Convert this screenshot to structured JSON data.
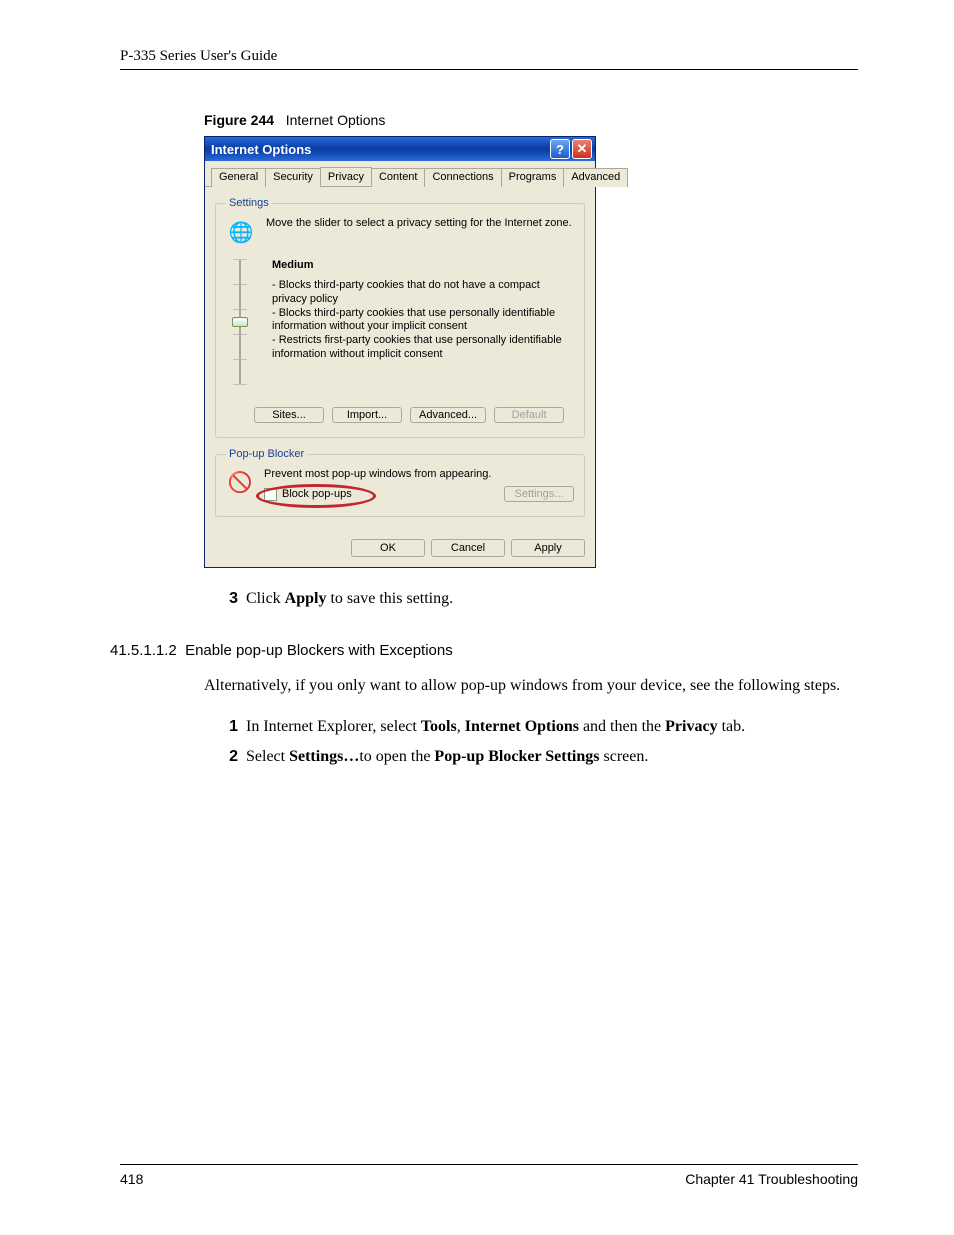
{
  "header": {
    "guide_title": "P-335 Series User's Guide"
  },
  "figure": {
    "number": "Figure 244",
    "title": "Internet Options"
  },
  "dialog": {
    "title": "Internet Options",
    "help_glyph": "?",
    "close_glyph": "✕",
    "tabs": {
      "general": "General",
      "security": "Security",
      "privacy": "Privacy",
      "content": "Content",
      "connections": "Connections",
      "programs": "Programs",
      "advanced": "Advanced"
    },
    "settings": {
      "legend": "Settings",
      "intro": "Move the slider to select a privacy setting for the Internet zone.",
      "level": "Medium",
      "desc": "- Blocks third-party cookies that do not have a compact privacy policy\n- Blocks third-party cookies that use personally identifiable information without your implicit consent\n- Restricts first-party cookies that use personally identifiable information without implicit consent",
      "buttons": {
        "sites": "Sites...",
        "import": "Import...",
        "advanced": "Advanced...",
        "default": "Default"
      }
    },
    "popup": {
      "legend": "Pop-up Blocker",
      "intro": "Prevent most pop-up windows from appearing.",
      "checkbox_label": "Block pop-ups",
      "settings_btn": "Settings..."
    },
    "buttons": {
      "ok": "OK",
      "cancel": "Cancel",
      "apply": "Apply"
    }
  },
  "step_after": {
    "num": "3",
    "text_a": "Click ",
    "text_b": "Apply",
    "text_c": " to save this setting."
  },
  "section": {
    "number": "41.5.1.1.2",
    "title": "Enable pop-up Blockers with Exceptions",
    "para": "Alternatively, if you only want to allow pop-up windows from your device, see the following steps.",
    "steps": [
      {
        "num": "1",
        "parts": [
          "In Internet Explorer, select ",
          "Tools",
          ", ",
          "Internet Options",
          " and then the ",
          "Privacy",
          " tab."
        ]
      },
      {
        "num": "2",
        "parts": [
          "Select ",
          "Settings…",
          "to open the ",
          "Pop-up Blocker Settings",
          " screen."
        ]
      }
    ]
  },
  "footer": {
    "page_num": "418",
    "chapter": "Chapter 41 Troubleshooting"
  },
  "icons": {
    "globe": "🌐",
    "block": "🚫"
  }
}
